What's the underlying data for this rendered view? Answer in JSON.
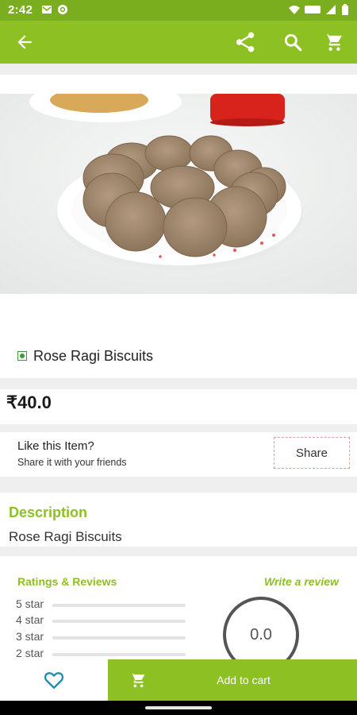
{
  "status_bar": {
    "time": "2:42"
  },
  "app_bar": {
    "back_icon": "arrow-back-icon",
    "share_icon": "share-icon",
    "search_icon": "search-icon",
    "cart_icon": "cart-icon"
  },
  "product": {
    "name": "Rose Ragi Biscuits",
    "price": "₹40.0",
    "veg_indicator": "veg-dot-icon"
  },
  "share_section": {
    "title": "Like this Item?",
    "subtitle": "Share it with your friends",
    "button_label": "Share"
  },
  "description": {
    "heading": "Description",
    "text": "Rose Ragi Biscuits"
  },
  "ratings": {
    "heading": "Ratings & Reviews",
    "write_review": "Write a review",
    "rows": [
      {
        "label": "5 star",
        "fraction": 0
      },
      {
        "label": "4 star",
        "fraction": 0
      },
      {
        "label": "3 star",
        "fraction": 0
      },
      {
        "label": "2 star",
        "fraction": 0
      }
    ],
    "average": "0.0"
  },
  "bottom_bar": {
    "wishlist_icon": "heart-icon",
    "add_to_cart_label": "Add to cart"
  },
  "colors": {
    "accent": "#8dc022",
    "status_bar": "#7aae1f",
    "veg_green": "#3a9a3a"
  }
}
